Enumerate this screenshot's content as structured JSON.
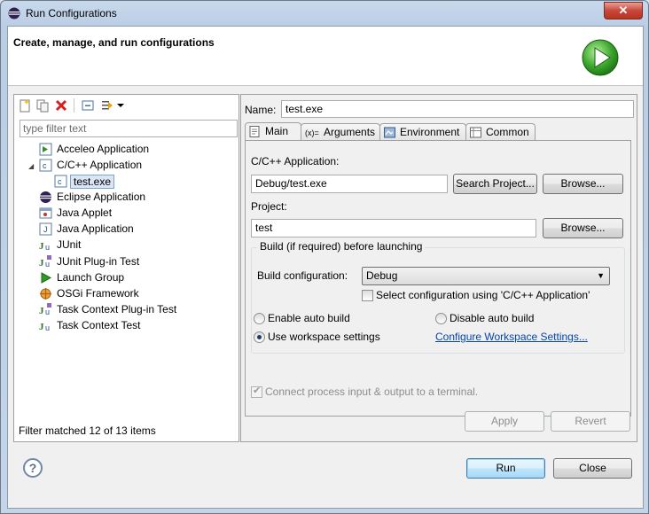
{
  "window": {
    "title": "Run Configurations",
    "close_glyph": "✕"
  },
  "header": {
    "title": "Create, manage, and run configurations"
  },
  "left": {
    "filter_placeholder": "type filter text",
    "tree": [
      {
        "label": "Acceleo Application",
        "icon": "acceleo-icon"
      },
      {
        "label": "C/C++ Application",
        "icon": "cpp-app-icon",
        "expanded": true
      },
      {
        "label": "test.exe",
        "icon": "cpp-config-icon",
        "selected": true
      },
      {
        "label": "Eclipse Application",
        "icon": "eclipse-icon"
      },
      {
        "label": "Java Applet",
        "icon": "applet-icon"
      },
      {
        "label": "Java Application",
        "icon": "java-app-icon"
      },
      {
        "label": "JUnit",
        "icon": "junit-icon"
      },
      {
        "label": "JUnit Plug-in Test",
        "icon": "junit-plugin-icon"
      },
      {
        "label": "Launch Group",
        "icon": "launch-group-icon"
      },
      {
        "label": "OSGi Framework",
        "icon": "osgi-icon"
      },
      {
        "label": "Task Context Plug-in Test",
        "icon": "task-plugin-icon"
      },
      {
        "label": "Task Context Test",
        "icon": "task-test-icon"
      }
    ],
    "status": "Filter matched 12 of 13 items"
  },
  "right": {
    "name_label": "Name:",
    "name_value": "test.exe",
    "tabs": [
      {
        "label": "Main",
        "icon": "main-tab-icon",
        "active": true
      },
      {
        "label": "Arguments",
        "icon": "arguments-tab-icon"
      },
      {
        "label": "Environment",
        "icon": "environment-tab-icon"
      },
      {
        "label": "Common",
        "icon": "common-tab-icon"
      }
    ],
    "main": {
      "app_label": "C/C++ Application:",
      "app_value": "Debug/test.exe",
      "search_project": "Search Project...",
      "browse": "Browse...",
      "project_label": "Project:",
      "project_value": "test",
      "build_group": "Build (if required) before launching",
      "build_config_label": "Build configuration:",
      "build_config_value": "Debug",
      "select_config": "Select configuration using 'C/C++ Application'",
      "enable_auto": "Enable auto build",
      "disable_auto": "Disable auto build",
      "use_workspace": "Use workspace settings",
      "configure_link": "Configure Workspace Settings...",
      "connect_terminal": "Connect process input & output to a terminal."
    },
    "apply": "Apply",
    "revert": "Revert"
  },
  "footer": {
    "run": "Run",
    "close": "Close",
    "help_glyph": "?"
  }
}
